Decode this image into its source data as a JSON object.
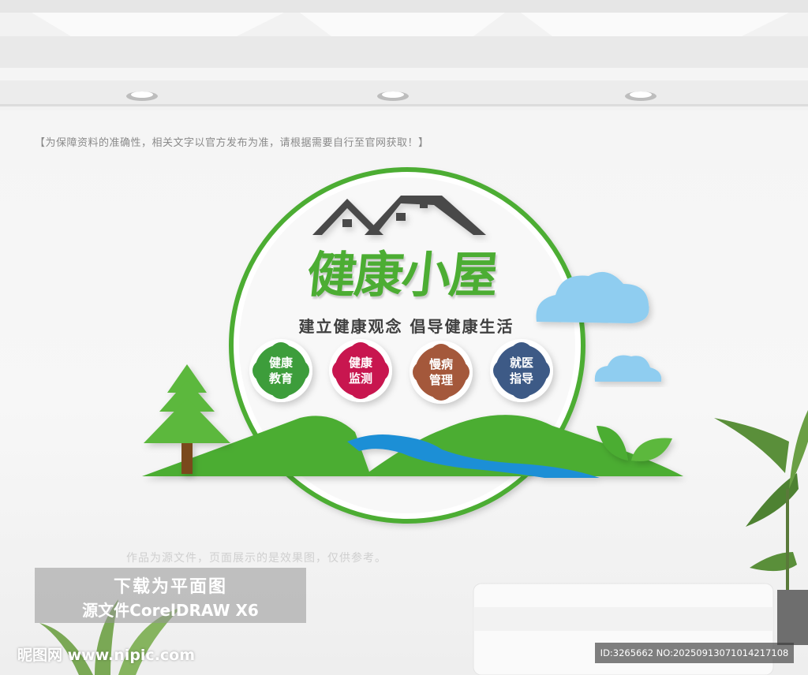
{
  "disclaimer": "【为保障资料的准确性，相关文字以官方发布为准，请根据需要自行至官网获取！】",
  "sign": {
    "title": "健康小屋",
    "slogan": "建立健康观念  倡导健康生活",
    "badges": [
      {
        "label": "健康\n教育",
        "color": "#3e9d3a"
      },
      {
        "label": "健康\n监测",
        "color": "#c8194f"
      },
      {
        "label": "慢病\n管理",
        "color": "#a4583a"
      },
      {
        "label": "就医\n指导",
        "color": "#3e5a86"
      }
    ]
  },
  "colors": {
    "brand_green": "#4cad33",
    "river_blue": "#1e8fd6",
    "cloud_blue": "#8fcdf0",
    "roof_gray": "#4a4a4a"
  },
  "note": "作品为源文件，页面展示的是效果图，仅供参考。",
  "download": {
    "line1": "下载为平面图",
    "line2": "源文件CorelDRAW X6"
  },
  "watermark": "昵图网 www.nipic.com",
  "id_text": "ID:3265662 NO:20250913071014217108"
}
